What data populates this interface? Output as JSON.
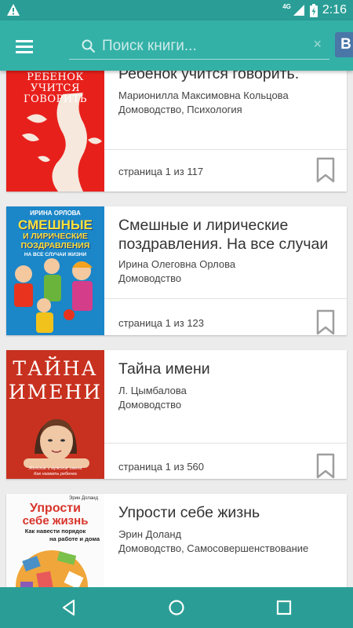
{
  "status_bar": {
    "network": "4G",
    "time": "2:16",
    "icons": [
      "warning-icon",
      "signal-icon",
      "battery-charging-icon"
    ]
  },
  "app_bar": {
    "menu_icon": "hamburger-menu-icon",
    "search": {
      "placeholder": "Поиск книги...",
      "value": ""
    },
    "clear_icon": "×",
    "vk_label": "B"
  },
  "books": [
    {
      "title": "Ребенок учится говорить.",
      "author": "Марионилла Максимовна Кольцова",
      "genre": "Домоводство, Психология",
      "pages": "страница 1 из 117",
      "cover_text": [
        "РЕБЕНОК",
        "УЧИТСЯ",
        "ГОВОРИТЬ"
      ]
    },
    {
      "title": "Смешные и лирические поздравления. На все случаи",
      "author": "Ирина Олеговна Орлова",
      "genre": "Домоводство",
      "pages": "страница 1 из 123",
      "cover_text": [
        "ИРИНА ОРЛОВА",
        "СМЕШНЫЕ",
        "И ЛИРИЧЕСКИЕ",
        "ПОЗДРАВЛЕНИЯ",
        "НА ВСЕ СЛУЧАИ ЖИЗНИ"
      ]
    },
    {
      "title": "Тайна имени",
      "author": "Л. Цымбалова",
      "genre": "Домоводство",
      "pages": "страница 1 из 560",
      "cover_text": [
        "ТАЙНА",
        "ИМЕНИ",
        "Женские и мужские имена",
        "Как назвать ребенка"
      ]
    },
    {
      "title": "Упрости себе жизнь",
      "author": "Эрин Доланд",
      "genre": "Домоводство, Самосовершенствование",
      "pages": "",
      "cover_text": [
        "Эрин Доланд",
        "Упрости",
        "себе жизнь",
        "Как навести порядок",
        "на работе и дома"
      ]
    }
  ],
  "colors": {
    "status_bar": "#2a9e96",
    "app_bar": "#33b1a7",
    "nav_bar": "#2a9e96",
    "vk": "#4a76a8",
    "bookmark": "#9e9e9e"
  },
  "nav_bar": {
    "icons": [
      "back-icon",
      "home-icon",
      "recents-icon"
    ]
  }
}
